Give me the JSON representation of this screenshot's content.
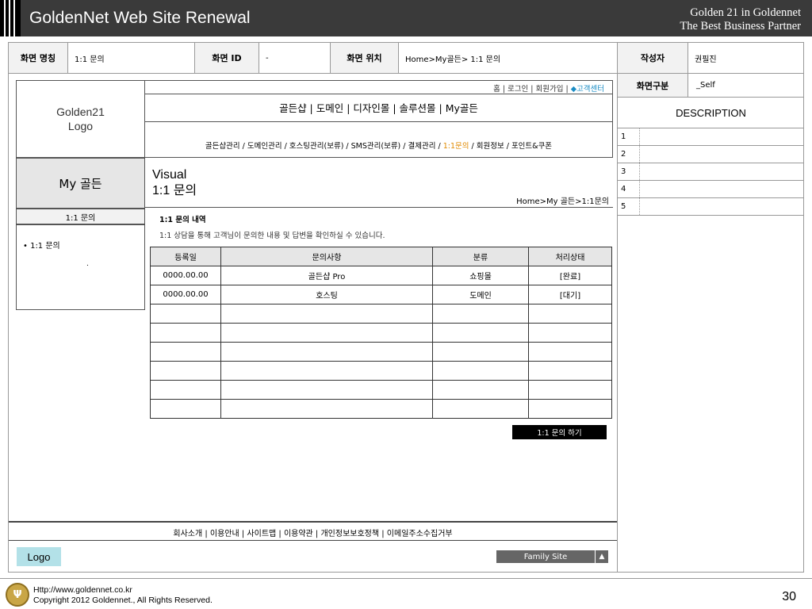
{
  "header": {
    "title": "GoldenNet Web Site Renewal",
    "tagline_1": "Golden 21 in Goldennet",
    "tagline_2": "The Best Business Partner"
  },
  "info": {
    "screen_name_label": "화면 명칭",
    "screen_name": "1:1 문의",
    "screen_id_label": "화면 ID",
    "screen_id": "-",
    "screen_location_label": "화면 위치",
    "screen_location": "Home>My골든> 1:1 문의",
    "author_label": "작성자",
    "author": "권필진"
  },
  "site": {
    "logo_text": "Golden21\nLogo",
    "util_links": "홈 | 로그인 | 회원가입 | ",
    "util_cs": "◆고객센터",
    "gnb": "골든샵 | 도메인 | 디자인몰 | 솔루션몰 | My골든",
    "lnb_before": "골든샵관리 / 도메인관리 / 호스팅관리(보류) / SMS관리(보류) / 결제관리 / ",
    "lnb_active": "1:1문의",
    "lnb_after": " / 회원정보 / 포인트&쿠폰",
    "section_title": "My 골든",
    "sub_nav": "1:1 문의",
    "side_item": "• 1:1 문의",
    "side_dot": ".",
    "visual": "Visual\n1:1 문의",
    "visual_path": "Home>My 골든>1:1문의",
    "content_title": "1:1 문의 내역",
    "content_desc": "1:1 상담을 통해 고객님이 문의한 내용 및 답변을 확인하실 수 있습니다.",
    "table": {
      "headers": [
        "등록일",
        "문의사항",
        "분류",
        "처리상태"
      ],
      "rows": [
        [
          "0000.00.00",
          "골든샵 Pro",
          "쇼핑몰",
          "[완료]"
        ],
        [
          "0000.00.00",
          "호스팅",
          "도메인",
          "[대기]"
        ]
      ]
    },
    "inquiry_button": "1:1 문의 하기",
    "footer_links": "회사소개 | 이용안내 | 사이트맵 | 이용약관 | 개인정보보호정책 | 이메일주소수집거부",
    "footer_logo": "Logo",
    "family_site": "Family Site",
    "family_arrow": "▲"
  },
  "description_panel": {
    "type_label": "화면구분",
    "type_value": "_Self",
    "title": "DESCRIPTION",
    "items": [
      "1",
      "2",
      "3",
      "4",
      "5"
    ]
  },
  "footer": {
    "url": "Http://www.goldennet.co.kr",
    "copyright": "Copyright 2012 Goldennet., All Rights Reserved.",
    "page_number": "30"
  }
}
